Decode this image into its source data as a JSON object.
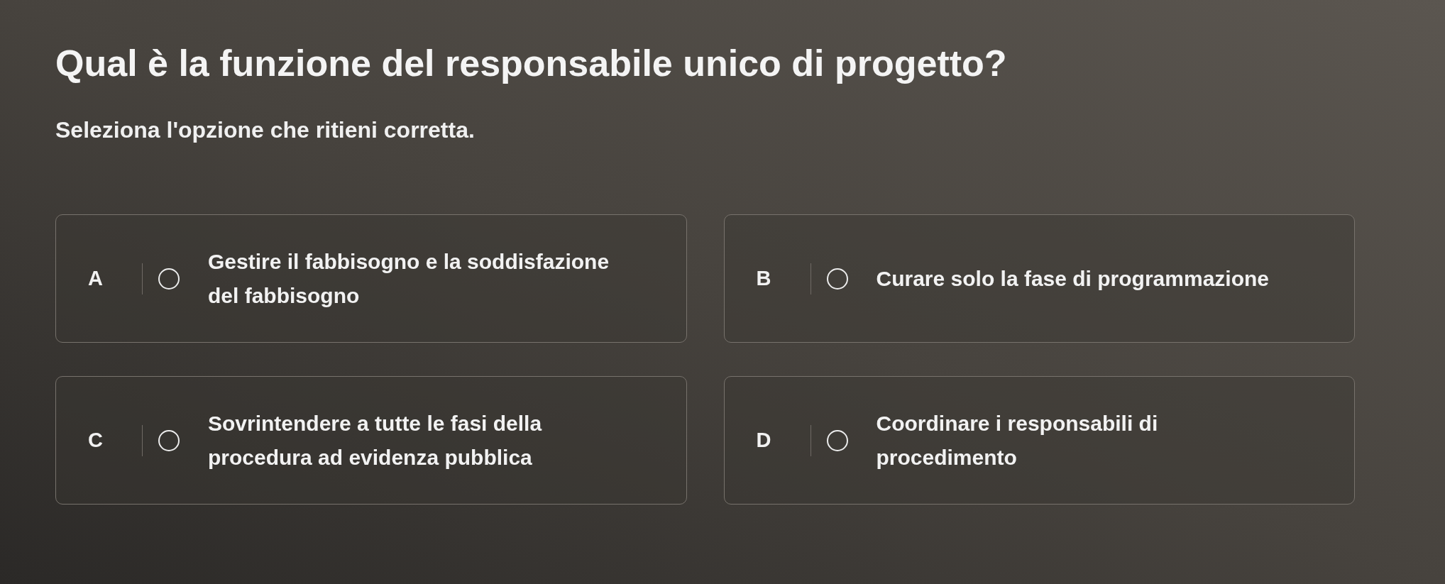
{
  "question": {
    "title": "Qual è la funzione del responsabile unico di progetto?",
    "instruction": "Seleziona l'opzione che ritieni corretta."
  },
  "options": [
    {
      "letter": "A",
      "text": "Gestire il fabbisogno e la soddisfazione\ndel fabbisogno",
      "selected": false
    },
    {
      "letter": "B",
      "text": "Curare solo la fase di programmazione",
      "selected": false
    },
    {
      "letter": "C",
      "text": "Sovrintendere a tutte le fasi della\nprocedura ad evidenza pubblica",
      "selected": false
    },
    {
      "letter": "D",
      "text": "Coordinare i responsabili di\nprocedimento",
      "selected": false
    }
  ]
}
